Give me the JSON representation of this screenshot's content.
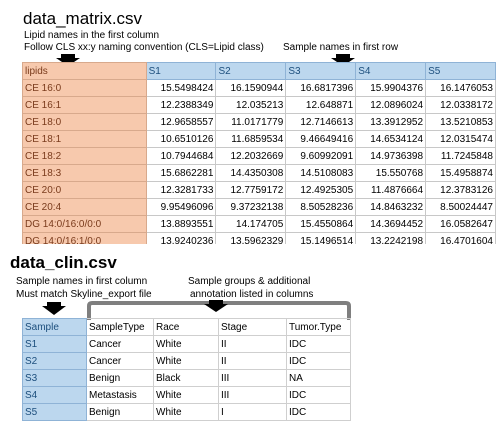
{
  "matrix_section": {
    "title": "data_matrix.csv",
    "note1": "Lipid names in the first column",
    "note2": "Follow CLS xx:y naming convention (CLS=Lipid class)",
    "note3": "Sample names in first row",
    "header": [
      "lipids",
      "S1",
      "S2",
      "S3",
      "S4",
      "S5"
    ],
    "rows": [
      [
        "CE 16:0",
        "15.5498424",
        "16.1590944",
        "16.6817396",
        "15.9904376",
        "16.1476053"
      ],
      [
        "CE 16:1",
        "12.2388349",
        "12.035213",
        "12.648871",
        "12.0896024",
        "12.0338172"
      ],
      [
        "CE 18:0",
        "12.9658557",
        "11.0171779",
        "12.7146613",
        "13.3912952",
        "13.5210853"
      ],
      [
        "CE 18:1",
        "10.6510126",
        "11.6859534",
        "9.46649416",
        "14.6534124",
        "12.0315474"
      ],
      [
        "CE 18:2",
        "10.7944684",
        "12.2032669",
        "9.60992091",
        "14.9736398",
        "11.7245848"
      ],
      [
        "CE 18:3",
        "15.6862281",
        "14.4350308",
        "14.5108083",
        "15.550768",
        "15.4958874"
      ],
      [
        "CE 20:0",
        "12.3281733",
        "12.7759172",
        "12.4925305",
        "11.4876664",
        "12.3783126"
      ],
      [
        "CE 20:4",
        "9.95496096",
        "9.37232138",
        "8.50528236",
        "14.8463232",
        "8.50024447"
      ],
      [
        "DG 14:0/16:0/0:0",
        "13.8893551",
        "14.174705",
        "15.4550864",
        "14.3694452",
        "16.0582647"
      ],
      [
        "DG 14:0/16:1/0:0",
        "13.9240236",
        "13.5962329",
        "15.1496514",
        "13.2242198",
        "16.4701604"
      ]
    ]
  },
  "clin_section": {
    "title": "data_clin.csv",
    "note1": "Sample names in first column",
    "note2": "Must match Skyline_export file",
    "note3": "Sample groups & additional",
    "note4": "annotation listed in columns",
    "header": [
      "Sample",
      "SampleType",
      "Race",
      "Stage",
      "Tumor.Type"
    ],
    "rows": [
      [
        "S1",
        "Cancer",
        "White",
        "II",
        "IDC"
      ],
      [
        "S2",
        "Cancer",
        "White",
        "II",
        "IDC"
      ],
      [
        "S3",
        "Benign",
        "Black",
        "III",
        "NA"
      ],
      [
        "S4",
        "Metastasis",
        "White",
        "III",
        "IDC"
      ],
      [
        "S5",
        "Benign",
        "White",
        "I",
        "IDC"
      ]
    ]
  },
  "colors": {
    "lipid_column": "#f7c9ad",
    "sample_header": "#bcd7ee"
  }
}
